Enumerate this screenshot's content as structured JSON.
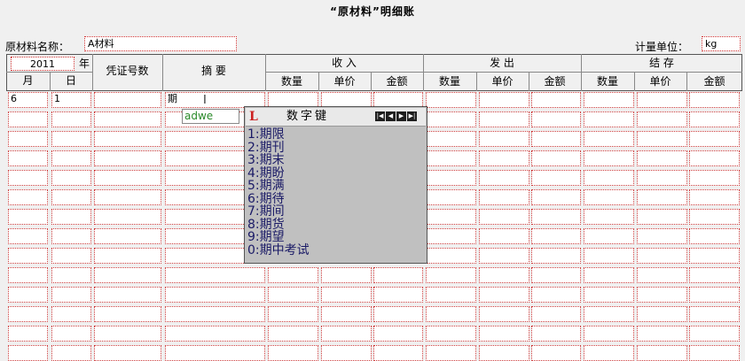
{
  "title": "“原材料”明细账",
  "material": {
    "label": "原材料名称：",
    "value": "A材料"
  },
  "unit": {
    "label": "计量单位：",
    "value": "kg"
  },
  "header": {
    "year_value": "2011",
    "year_label": "年",
    "month": "月",
    "day": "日",
    "voucher": "凭证号数",
    "summary": "摘 要",
    "income": "收 入",
    "outgo": "发 出",
    "balance": "结 存",
    "qty": "数量",
    "price": "单价",
    "amount": "金额"
  },
  "rows": [
    {
      "month": "6",
      "day": "1",
      "voucher": "",
      "summary": "期"
    }
  ],
  "ime": {
    "composition": "adwe",
    "title": "数字键",
    "logo": "L",
    "nav": [
      "|◀",
      "◀",
      "▶",
      "▶|"
    ],
    "candidates": [
      "1:期限",
      "2:期刊",
      "3:期末",
      "4:期盼",
      "5:期满",
      "6:期待",
      "7:期间",
      "8:期货",
      "9:期望",
      "0:期中考试"
    ]
  }
}
